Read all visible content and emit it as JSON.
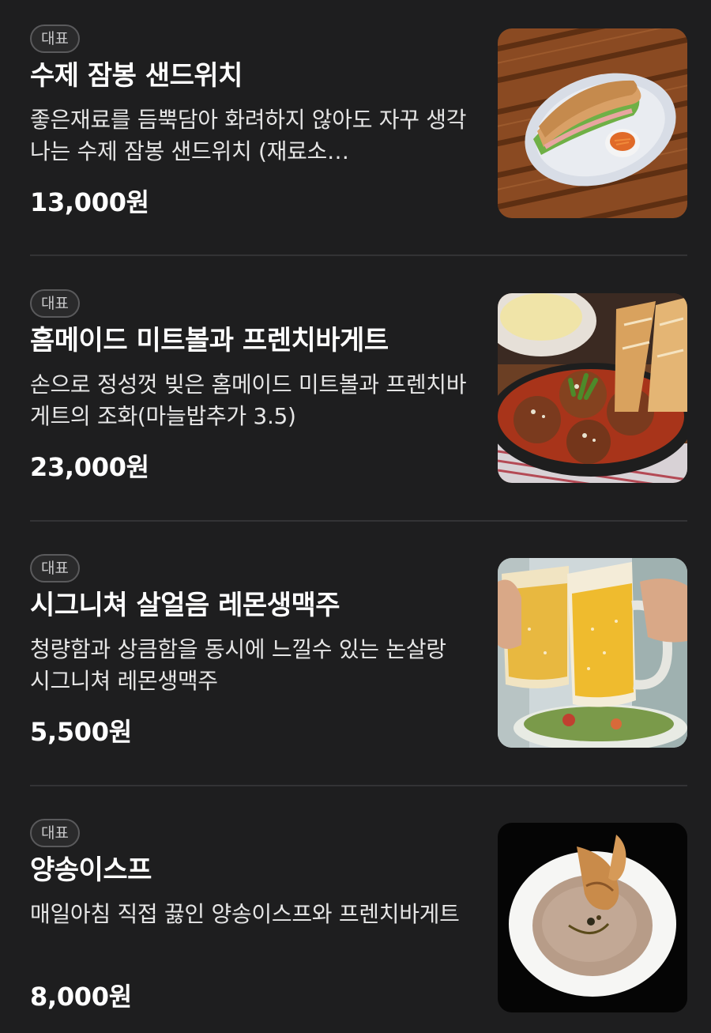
{
  "menu": {
    "items": [
      {
        "badge": "대표",
        "name": "수제 잠봉 샌드위치",
        "description": "좋은재료를 듬뿍담아 화려하지 않아도 자꾸 생각나는 수제 잠봉 샌드위치 (재료소…",
        "price": "13,000원",
        "image_icon": "sandwich-photo"
      },
      {
        "badge": "대표",
        "name": "홈메이드 미트볼과 프렌치바게트",
        "description": "손으로 정성껏 빚은 홈메이드 미트볼과 프렌치바게트의 조화(마늘밥추가 3.5)",
        "price": "23,000원",
        "image_icon": "meatball-photo"
      },
      {
        "badge": "대표",
        "name": "시그니쳐 살얼음 레몬생맥주",
        "description": "청량함과 상큼함을 동시에 느낄수 있는 논살랑 시그니쳐 레몬생맥주",
        "price": "5,500원",
        "image_icon": "beer-photo"
      },
      {
        "badge": "대표",
        "name": "양송이스프",
        "description": "매일아침 직접 끓인 양송이스프와 프렌치바게트",
        "price": "8,000원",
        "image_icon": "mushroom-soup-photo"
      }
    ]
  }
}
